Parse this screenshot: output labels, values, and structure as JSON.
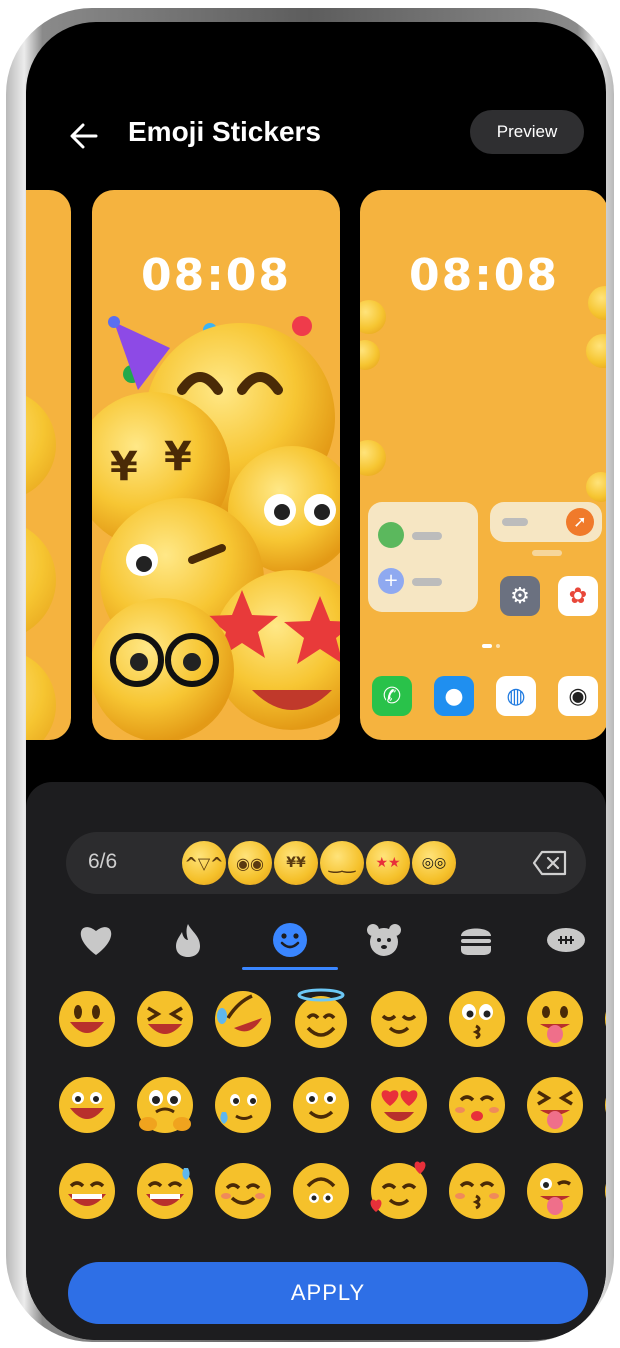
{
  "header": {
    "title": "Emoji Stickers",
    "preview_label": "Preview"
  },
  "wallpapers": {
    "lock_time": "08:08",
    "home_time": "08:08",
    "background_color": "#f5b33f"
  },
  "selection": {
    "count": "6/6",
    "selected": [
      "party-face",
      "flushed-face",
      "yen-eyes-face",
      "smirk-face",
      "star-struck-face",
      "nerd-glasses-face"
    ]
  },
  "categories": [
    {
      "name": "heart-icon",
      "active": false
    },
    {
      "name": "fire-icon",
      "active": false
    },
    {
      "name": "smiley-icon",
      "active": true
    },
    {
      "name": "bear-icon",
      "active": false
    },
    {
      "name": "burger-icon",
      "active": false
    },
    {
      "name": "football-icon",
      "active": false
    }
  ],
  "emoji_grid": [
    [
      "grinning",
      "squinting-laugh",
      "rolling-laugh",
      "halo-smile",
      "relieved",
      "kissing",
      "tongue-out",
      "partial"
    ],
    [
      "open-mouth-grin",
      "teary-hold",
      "sweat-smile",
      "slight-smile",
      "heart-eyes",
      "kiss-blush",
      "squint-tongue",
      "partial"
    ],
    [
      "grin-teeth",
      "sweat-grin",
      "blush-smile",
      "upside-down",
      "hearts-face",
      "kissing-closed-eyes",
      "winking-tongue",
      "partial"
    ]
  ],
  "apply_label": "APPLY",
  "colors": {
    "accent": "#2e6fe6",
    "active_tab": "#3a86ff",
    "emoji_yellow": "#f5c12b"
  }
}
